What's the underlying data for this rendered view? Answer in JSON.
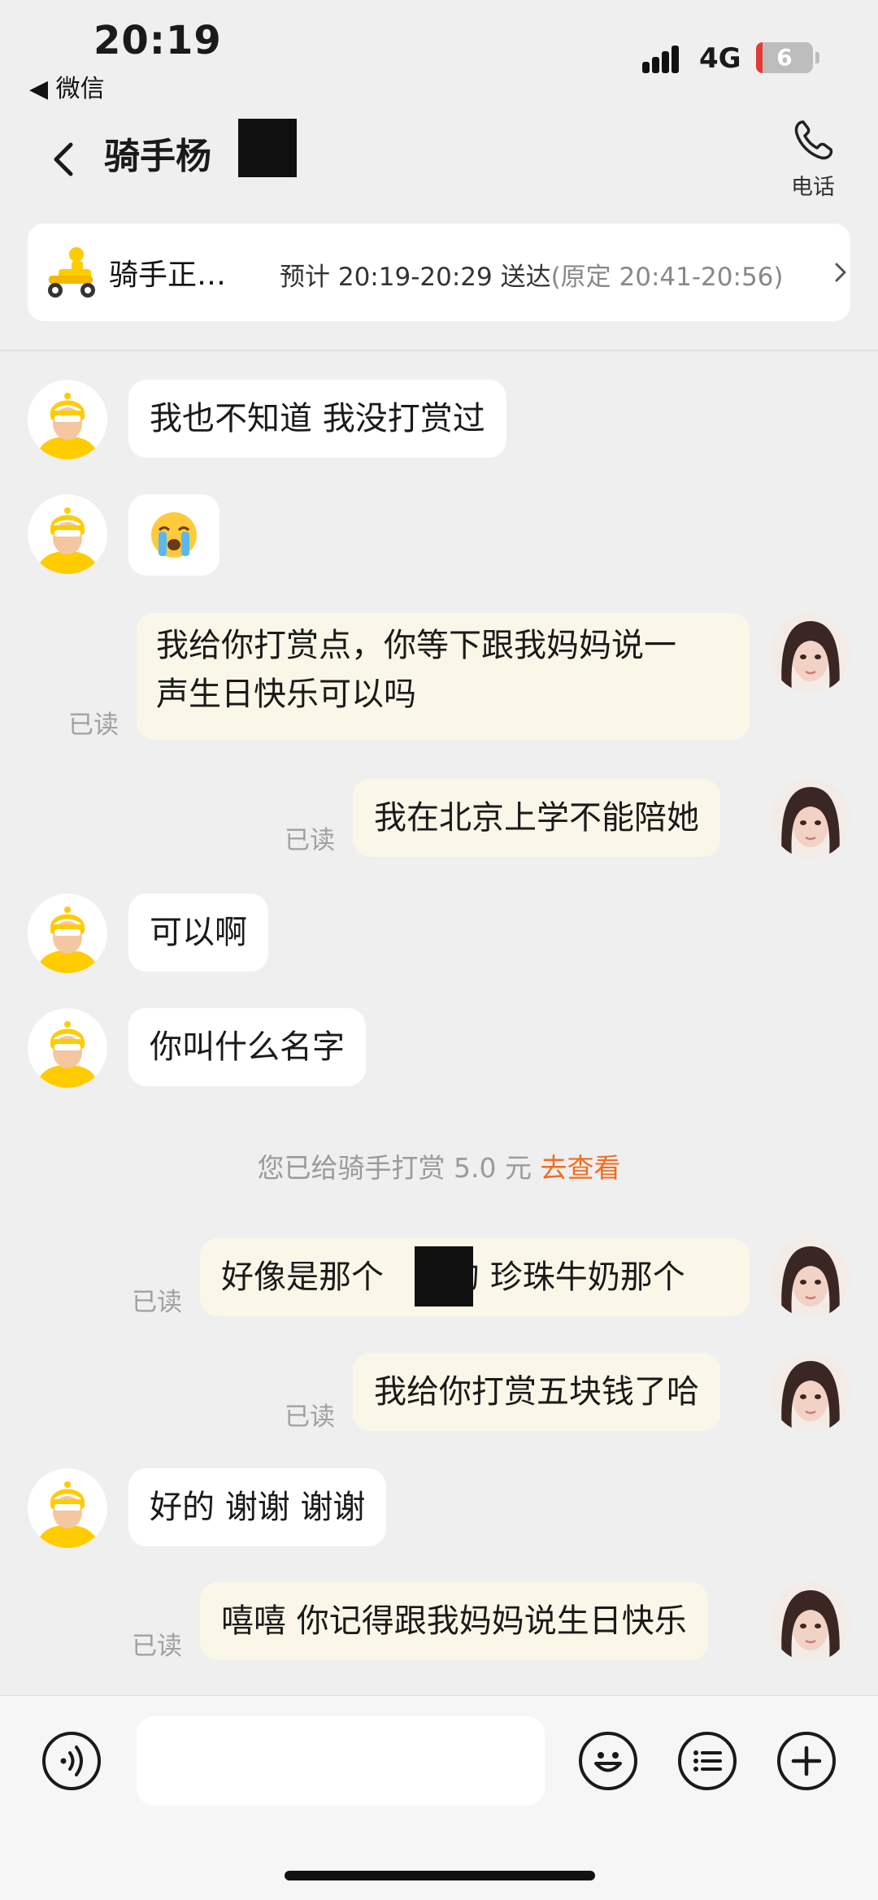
{
  "status_bar": {
    "time": "20:19",
    "back_app": "◀ 微信",
    "network": "4G",
    "battery": "6"
  },
  "header": {
    "title": "骑手杨",
    "call_label": "电话"
  },
  "delivery": {
    "status": "骑手正…",
    "eta_label": "预计 20:19-20:29 送达",
    "original_eta": "(原定 20:41-20:56)"
  },
  "messages": [
    {
      "side": "in",
      "text": "我也不知道 我没打赏过"
    },
    {
      "side": "in",
      "emoji": "😭"
    },
    {
      "side": "out",
      "read": "已读",
      "lines": [
        "我给你打赏点，你等下跟我妈妈说一",
        "声生日快乐可以吗"
      ]
    },
    {
      "side": "out",
      "read": "已读",
      "text": "我在北京上学不能陪她"
    },
    {
      "side": "in",
      "text": "可以啊"
    },
    {
      "side": "in",
      "text": "你叫什么名字"
    },
    {
      "side": "out",
      "read": "已读",
      "text_before": "好像是那个",
      "text_after": "的 珍珠牛奶那个"
    },
    {
      "side": "out",
      "read": "已读",
      "text": "我给你打赏五块钱了哈"
    },
    {
      "side": "in",
      "text": "好的 谢谢 谢谢"
    },
    {
      "side": "out",
      "read": "已读",
      "text": "嘻嘻 你记得跟我妈妈说生日快乐"
    }
  ],
  "system_notice": {
    "text": "您已给骑手打赏 5.0 元",
    "link": "去查看"
  },
  "colors": {
    "link": "#f26d1f",
    "rider_helmet": "#ffcc00",
    "outgoing_bubble": "#fbf7e8"
  },
  "icons": [
    "back-chevron-icon",
    "phone-icon",
    "rider-scooter-icon",
    "chevron-right-icon",
    "voice-icon",
    "emoji-icon",
    "list-icon",
    "plus-icon"
  ]
}
